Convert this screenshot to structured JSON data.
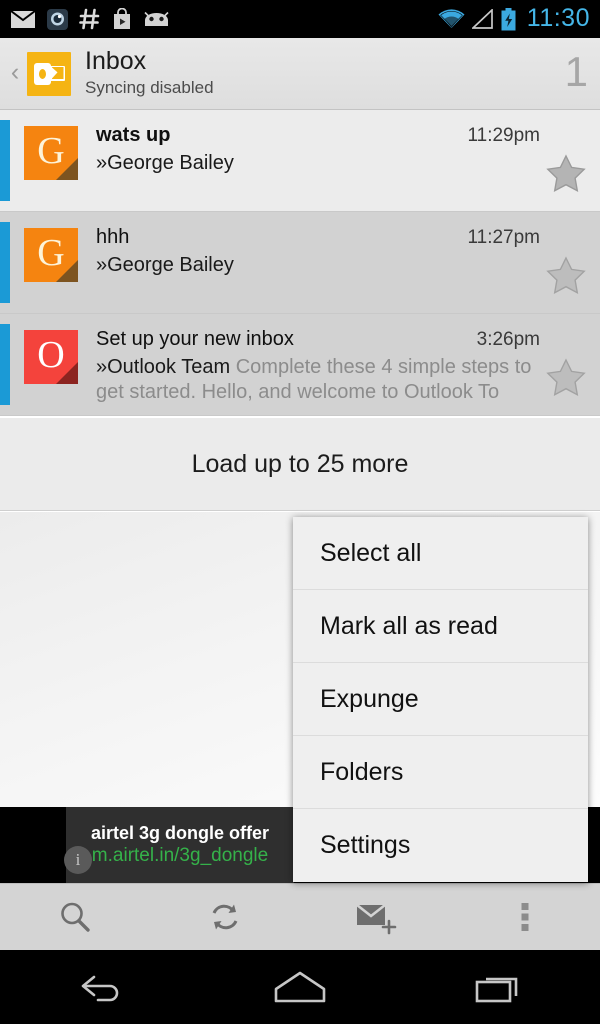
{
  "statusbar": {
    "notification_icons": [
      "envelope-icon",
      "eye-icon",
      "hash-icon",
      "play-store-icon",
      "android-face-icon"
    ],
    "system_icons": [
      "wifi-icon",
      "cellular-signal-icon",
      "battery-charging-icon"
    ],
    "clock": "11:30",
    "clock_color": "#45b6e8"
  },
  "actionbar": {
    "back_glyph": "‹",
    "app_icon": "outlook-app-icon",
    "app_icon_color": "#f5b413",
    "title": "Inbox",
    "subtitle": "Syncing disabled",
    "count": "1"
  },
  "mail_list": [
    {
      "subject": "wats up",
      "sender": "»George Bailey",
      "preview": "",
      "time": "11:29pm",
      "avatar_letter": "G",
      "avatar_color": "#f58410",
      "avatar_fold_color": "#7d5420",
      "avatar_letter_color": "#fdf3d8",
      "state": "unread",
      "starred": false
    },
    {
      "subject": "hhh",
      "sender": "»George Bailey",
      "preview": "",
      "time": "11:27pm",
      "avatar_letter": "G",
      "avatar_color": "#f58410",
      "avatar_fold_color": "#7d5420",
      "avatar_letter_color": "#fdf3d8",
      "state": "read",
      "starred": false
    },
    {
      "subject": "Set up your new inbox",
      "sender": "»Outlook Team",
      "preview": " Complete these 4 simple steps to get started. Hello, and welcome to Outlook To",
      "time": "3:26pm",
      "avatar_letter": "O",
      "avatar_color": "#f4433c",
      "avatar_fold_color": "#8c2420",
      "avatar_letter_color": "#ffffff",
      "state": "read",
      "starred": false
    }
  ],
  "load_more": {
    "label": "Load up to 25 more"
  },
  "menu": {
    "items": [
      {
        "label": "Select all"
      },
      {
        "label": "Mark all as read"
      },
      {
        "label": "Expunge"
      },
      {
        "label": "Folders"
      },
      {
        "label": "Settings"
      }
    ]
  },
  "ad": {
    "title": "airtel 3g dongle offer",
    "url": "m.airtel.in/3g_dongle",
    "url_color": "#35b24a",
    "info_glyph": "i"
  },
  "toolbar": {
    "buttons": [
      "search-icon",
      "refresh-icon",
      "compose-icon",
      "overflow-menu-icon"
    ]
  },
  "navbar": {
    "buttons": [
      "back-nav-icon",
      "home-nav-icon",
      "recents-nav-icon"
    ]
  },
  "colors": {
    "accent_stripe": "#1b9ad6",
    "unread_row": "#ececec",
    "read_row": "#d2d2d2",
    "menu_bg": "#efefef"
  }
}
